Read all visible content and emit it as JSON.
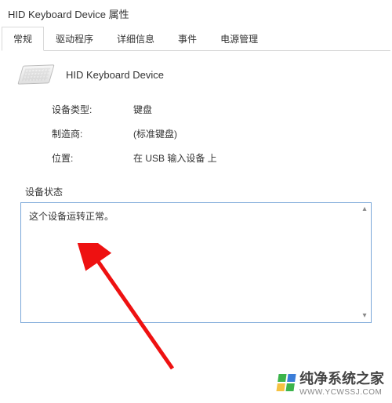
{
  "window": {
    "title": "HID Keyboard Device 属性"
  },
  "tabs": [
    {
      "label": "常规",
      "active": true
    },
    {
      "label": "驱动程序",
      "active": false
    },
    {
      "label": "详细信息",
      "active": false
    },
    {
      "label": "事件",
      "active": false
    },
    {
      "label": "电源管理",
      "active": false
    }
  ],
  "device": {
    "name": "HID Keyboard Device"
  },
  "info": {
    "type_label": "设备类型:",
    "type_value": "键盘",
    "manufacturer_label": "制造商:",
    "manufacturer_value": "(标准键盘)",
    "location_label": "位置:",
    "location_value": "在 USB 输入设备 上"
  },
  "status": {
    "label": "设备状态",
    "text": "这个设备运转正常。"
  },
  "watermark": {
    "text": "纯净系统之家",
    "sub": "WWW.YCWSSJ.COM"
  }
}
